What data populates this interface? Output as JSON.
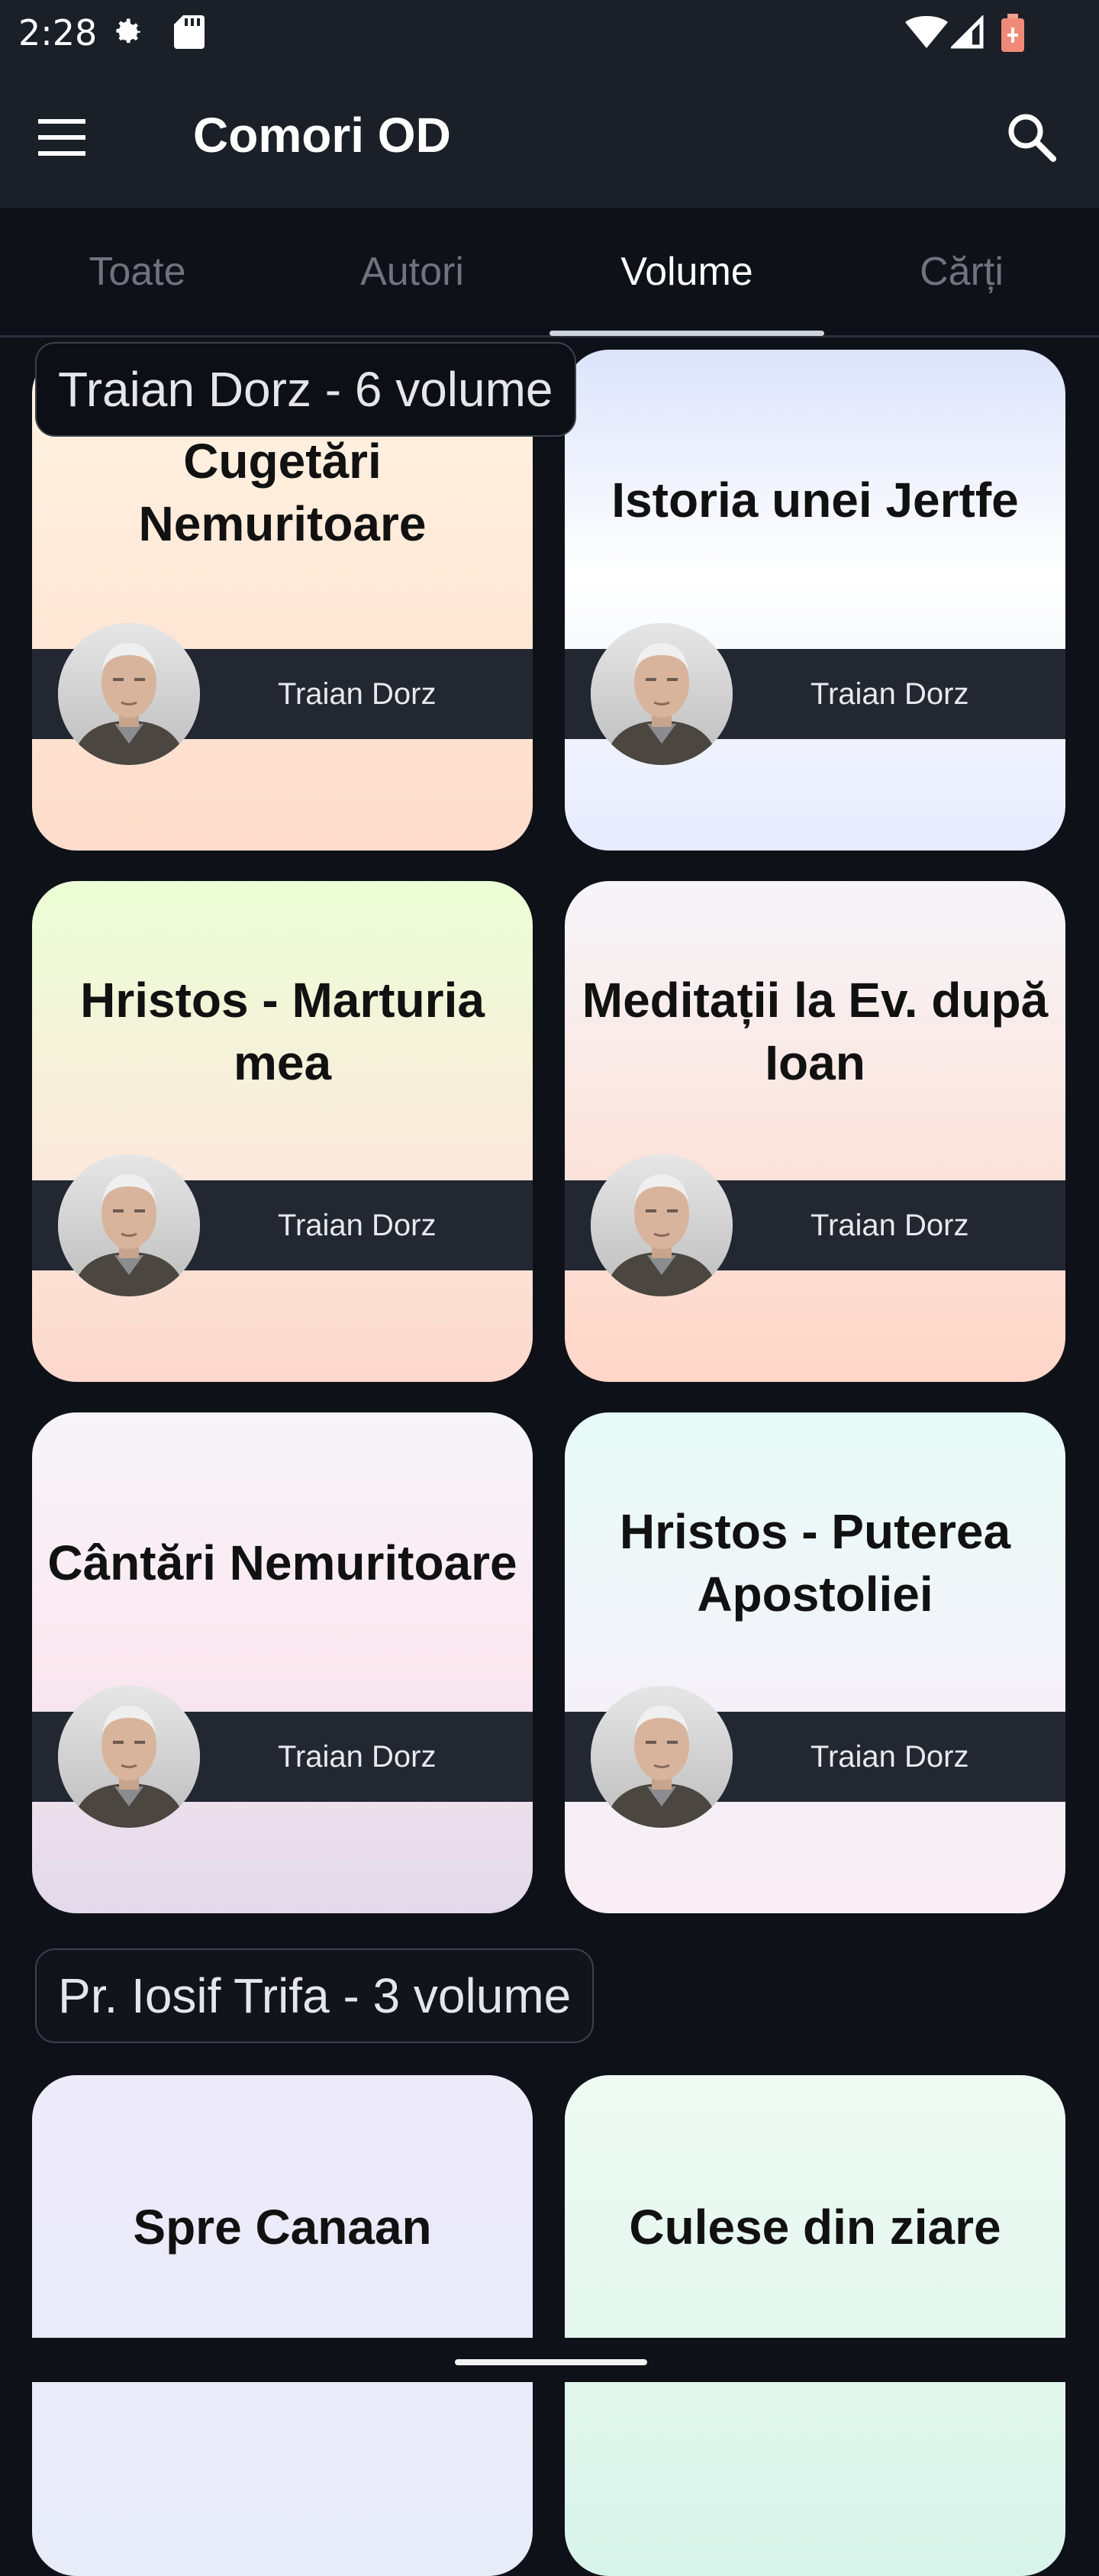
{
  "status_bar": {
    "time": "2:28",
    "icons": [
      "gear-icon",
      "sd-card-icon",
      "wifi-icon",
      "signal-icon",
      "battery-icon"
    ]
  },
  "app_bar": {
    "title": "Comori OD",
    "menu_icon": "menu-icon",
    "search_icon": "search-icon"
  },
  "tabs": [
    {
      "label": "Toate",
      "active": false
    },
    {
      "label": "Autori",
      "active": false
    },
    {
      "label": "Volume",
      "active": true
    },
    {
      "label": "Cărți",
      "active": false
    }
  ],
  "sections": [
    {
      "header": "Traian Dorz - 6 volume",
      "cards": [
        {
          "title": "Cugetări Nemuritoare",
          "author": "Traian Dorz"
        },
        {
          "title": "Istoria unei Jertfe",
          "author": "Traian Dorz"
        },
        {
          "title": "Hristos - Marturia mea",
          "author": "Traian Dorz"
        },
        {
          "title": "Meditații la Ev. după Ioan",
          "author": "Traian Dorz"
        },
        {
          "title": "Cântări Nemuritoare",
          "author": "Traian Dorz"
        },
        {
          "title": "Hristos - Puterea Apostoliei",
          "author": "Traian Dorz"
        }
      ]
    },
    {
      "header": "Pr. Iosif Trifa - 3 volume",
      "cards": [
        {
          "title": "Spre Canaan"
        },
        {
          "title": "Culese din ziare"
        }
      ]
    }
  ],
  "colors": {
    "background": "#0e1118",
    "app_bar": "#1b1f27",
    "author_band": "#222731",
    "tab_active": "#ffffff",
    "tab_inactive": "#6f747c"
  }
}
